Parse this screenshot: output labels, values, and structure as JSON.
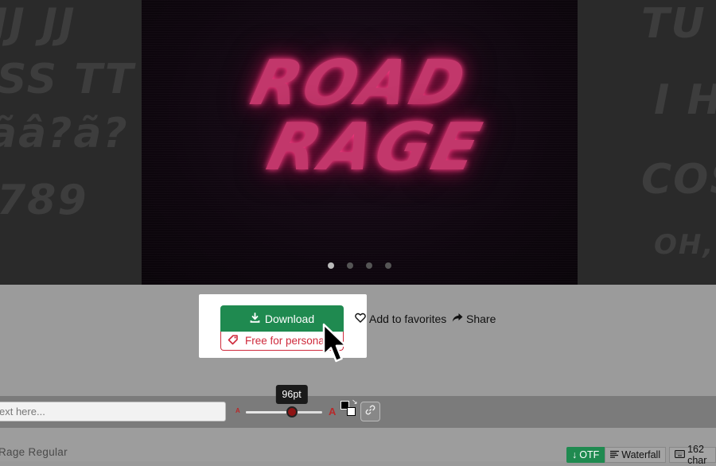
{
  "hero": {
    "ghost_left": [
      "JJ JJ",
      "SS TT",
      "ãâ?ã?",
      "789"
    ],
    "ghost_right": [
      "TU",
      "I HA",
      "COS",
      "OH, TH"
    ],
    "logo_line1": "ROAD",
    "logo_line2": "RAGE",
    "carousel": {
      "count": 4,
      "active": 1
    }
  },
  "actions": {
    "download_label": "Download",
    "license_label": "Free for personal",
    "favorites_label": "Add to favorites",
    "share_label": "Share"
  },
  "toolbar": {
    "text_input_value": "ext here...",
    "size_small_glyph": "A",
    "size_large_glyph": "A",
    "size_tooltip": "96pt",
    "size_fraction": 0.6
  },
  "bottom": {
    "font_name": "Rage Regular",
    "format_label": "OTF",
    "waterfall_label": "Waterfall",
    "chars_label": "162 char"
  },
  "colors": {
    "download_green": "#1f8a50",
    "license_red": "#cf2a3c",
    "neon_pink": "#c2376b"
  }
}
